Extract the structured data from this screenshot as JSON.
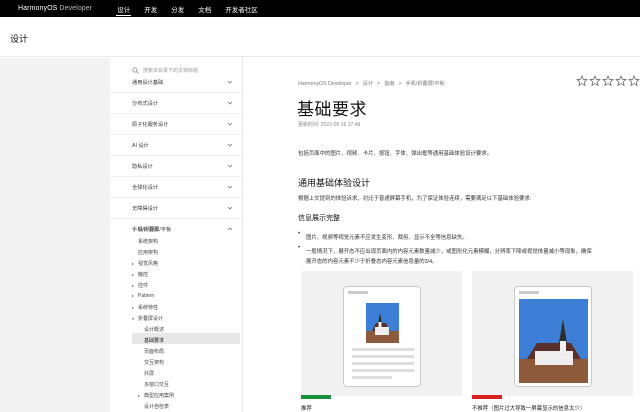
{
  "nav": {
    "logo": "HarmonyOS",
    "logo_sub": "Developer",
    "links": [
      "设计",
      "开发",
      "分发",
      "文档",
      "开发者社区"
    ]
  },
  "subheader": {
    "title": "设计"
  },
  "sidebar": {
    "search_placeholder": "搜索本目录下的文档标题",
    "items": [
      "通用设计基础",
      "分布式设计",
      "原子化服务设计",
      "AI 设计",
      "隐私设计",
      "全球化设计",
      "无障碍设计",
      "手机/折叠屏/平板"
    ],
    "subitems": [
      "设计原则",
      "系统架构",
      "应用架构"
    ],
    "groups": [
      "视觉风格",
      "触控",
      "控件",
      "Pattern",
      "系统特性",
      "折叠屏设计"
    ],
    "fold_items": [
      "设计概述",
      "基础要求",
      "页面布局",
      "交互架构",
      "外屏",
      "多窗口交互"
    ],
    "typical": "典型应用案例",
    "checklist": "设计自检表"
  },
  "main": {
    "breadcrumbs": [
      "HarmonyOS Developer",
      ">",
      "设计",
      ">",
      "指南",
      ">",
      "手机/折叠屏/平板"
    ],
    "title": "基础要求",
    "updated": "更新时间: 2022-05-16 17:48",
    "intro": "包括页面中的图片、视频、卡片、按钮、字体、弹出框等通用基础体验设计要求。",
    "h2": "通用基础体验设计",
    "h2_desc": "根据上文提到的体验诉求，对比于普通屏幕手机，为了保证体验连续，需要满足以下基础体验要求:",
    "h3": "信息展示完整",
    "bullet1": "图片、视频等视觉元素不应发生变形、裁剪、显示不全等信息缺失。",
    "bullet2_line1": "一般情况下，展开态不应出现页面内的内容元素数量减少，或图形化元素模糊，分辨率下降或视觉体量减小等现象，确保",
    "bullet2_line2": "展开态的内容元素不少于折叠态内容元素信息量的3/4。",
    "good_caption": "推荐",
    "bad_caption": "不推荐（图片过大导致一屏幕显示的信息太少）"
  },
  "colors": {
    "good": "#188f3a",
    "bad": "#d72020",
    "nav_bg": "#000000"
  }
}
